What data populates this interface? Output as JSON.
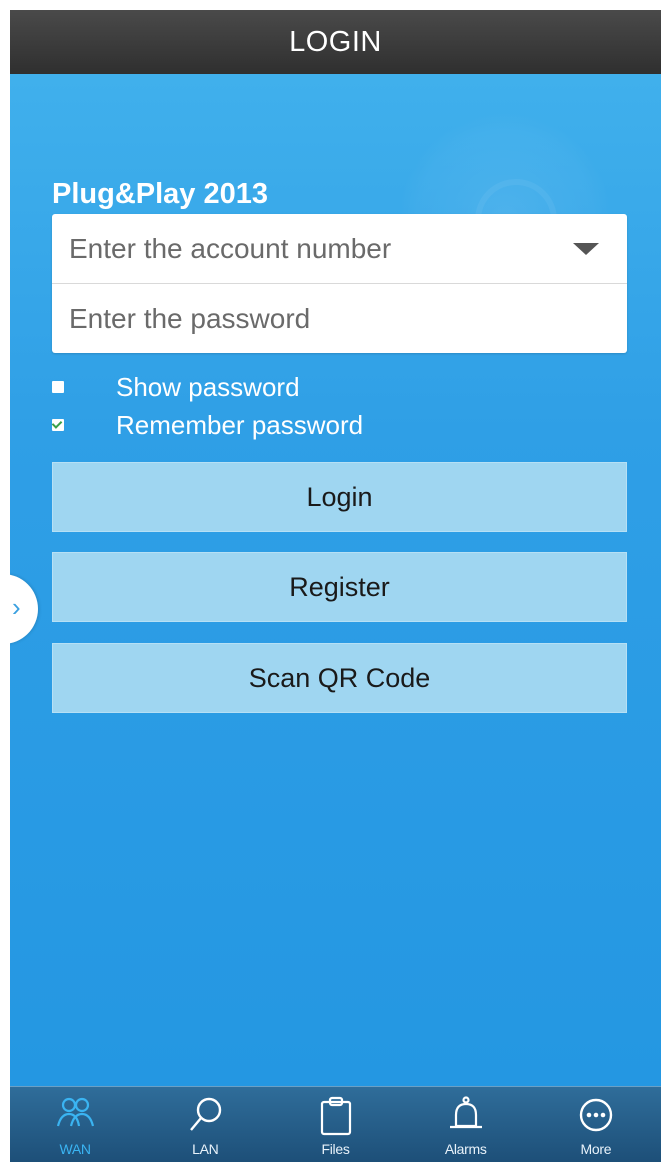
{
  "title_bar": {
    "title": "LOGIN"
  },
  "app_name": "Plug&Play 2013",
  "form": {
    "account_placeholder": "Enter the account number",
    "password_placeholder": "Enter the password"
  },
  "options": {
    "show_password": {
      "label": "Show password",
      "checked": false
    },
    "remember_password": {
      "label": "Remember password",
      "checked": true
    }
  },
  "buttons": {
    "login": "Login",
    "register": "Register",
    "scan_qr": "Scan QR Code"
  },
  "side_handle": {
    "glyph": "›",
    "icon": "chevron-right-icon"
  },
  "tabs": [
    {
      "label": "WAN",
      "icon": "users-icon",
      "active": true
    },
    {
      "label": "LAN",
      "icon": "search-icon",
      "active": false
    },
    {
      "label": "Files",
      "icon": "clipboard-icon",
      "active": false
    },
    {
      "label": "Alarms",
      "icon": "bell-icon",
      "active": false
    },
    {
      "label": "More",
      "icon": "more-icon",
      "active": false
    }
  ],
  "colors": {
    "title_bar": "#3a3a3a",
    "background": "#2a9be4",
    "button": "#9fd6f1",
    "tab_bar": "#245d88",
    "tab_active": "#3ab4f2",
    "checkbox_check": "#3aa04a"
  }
}
